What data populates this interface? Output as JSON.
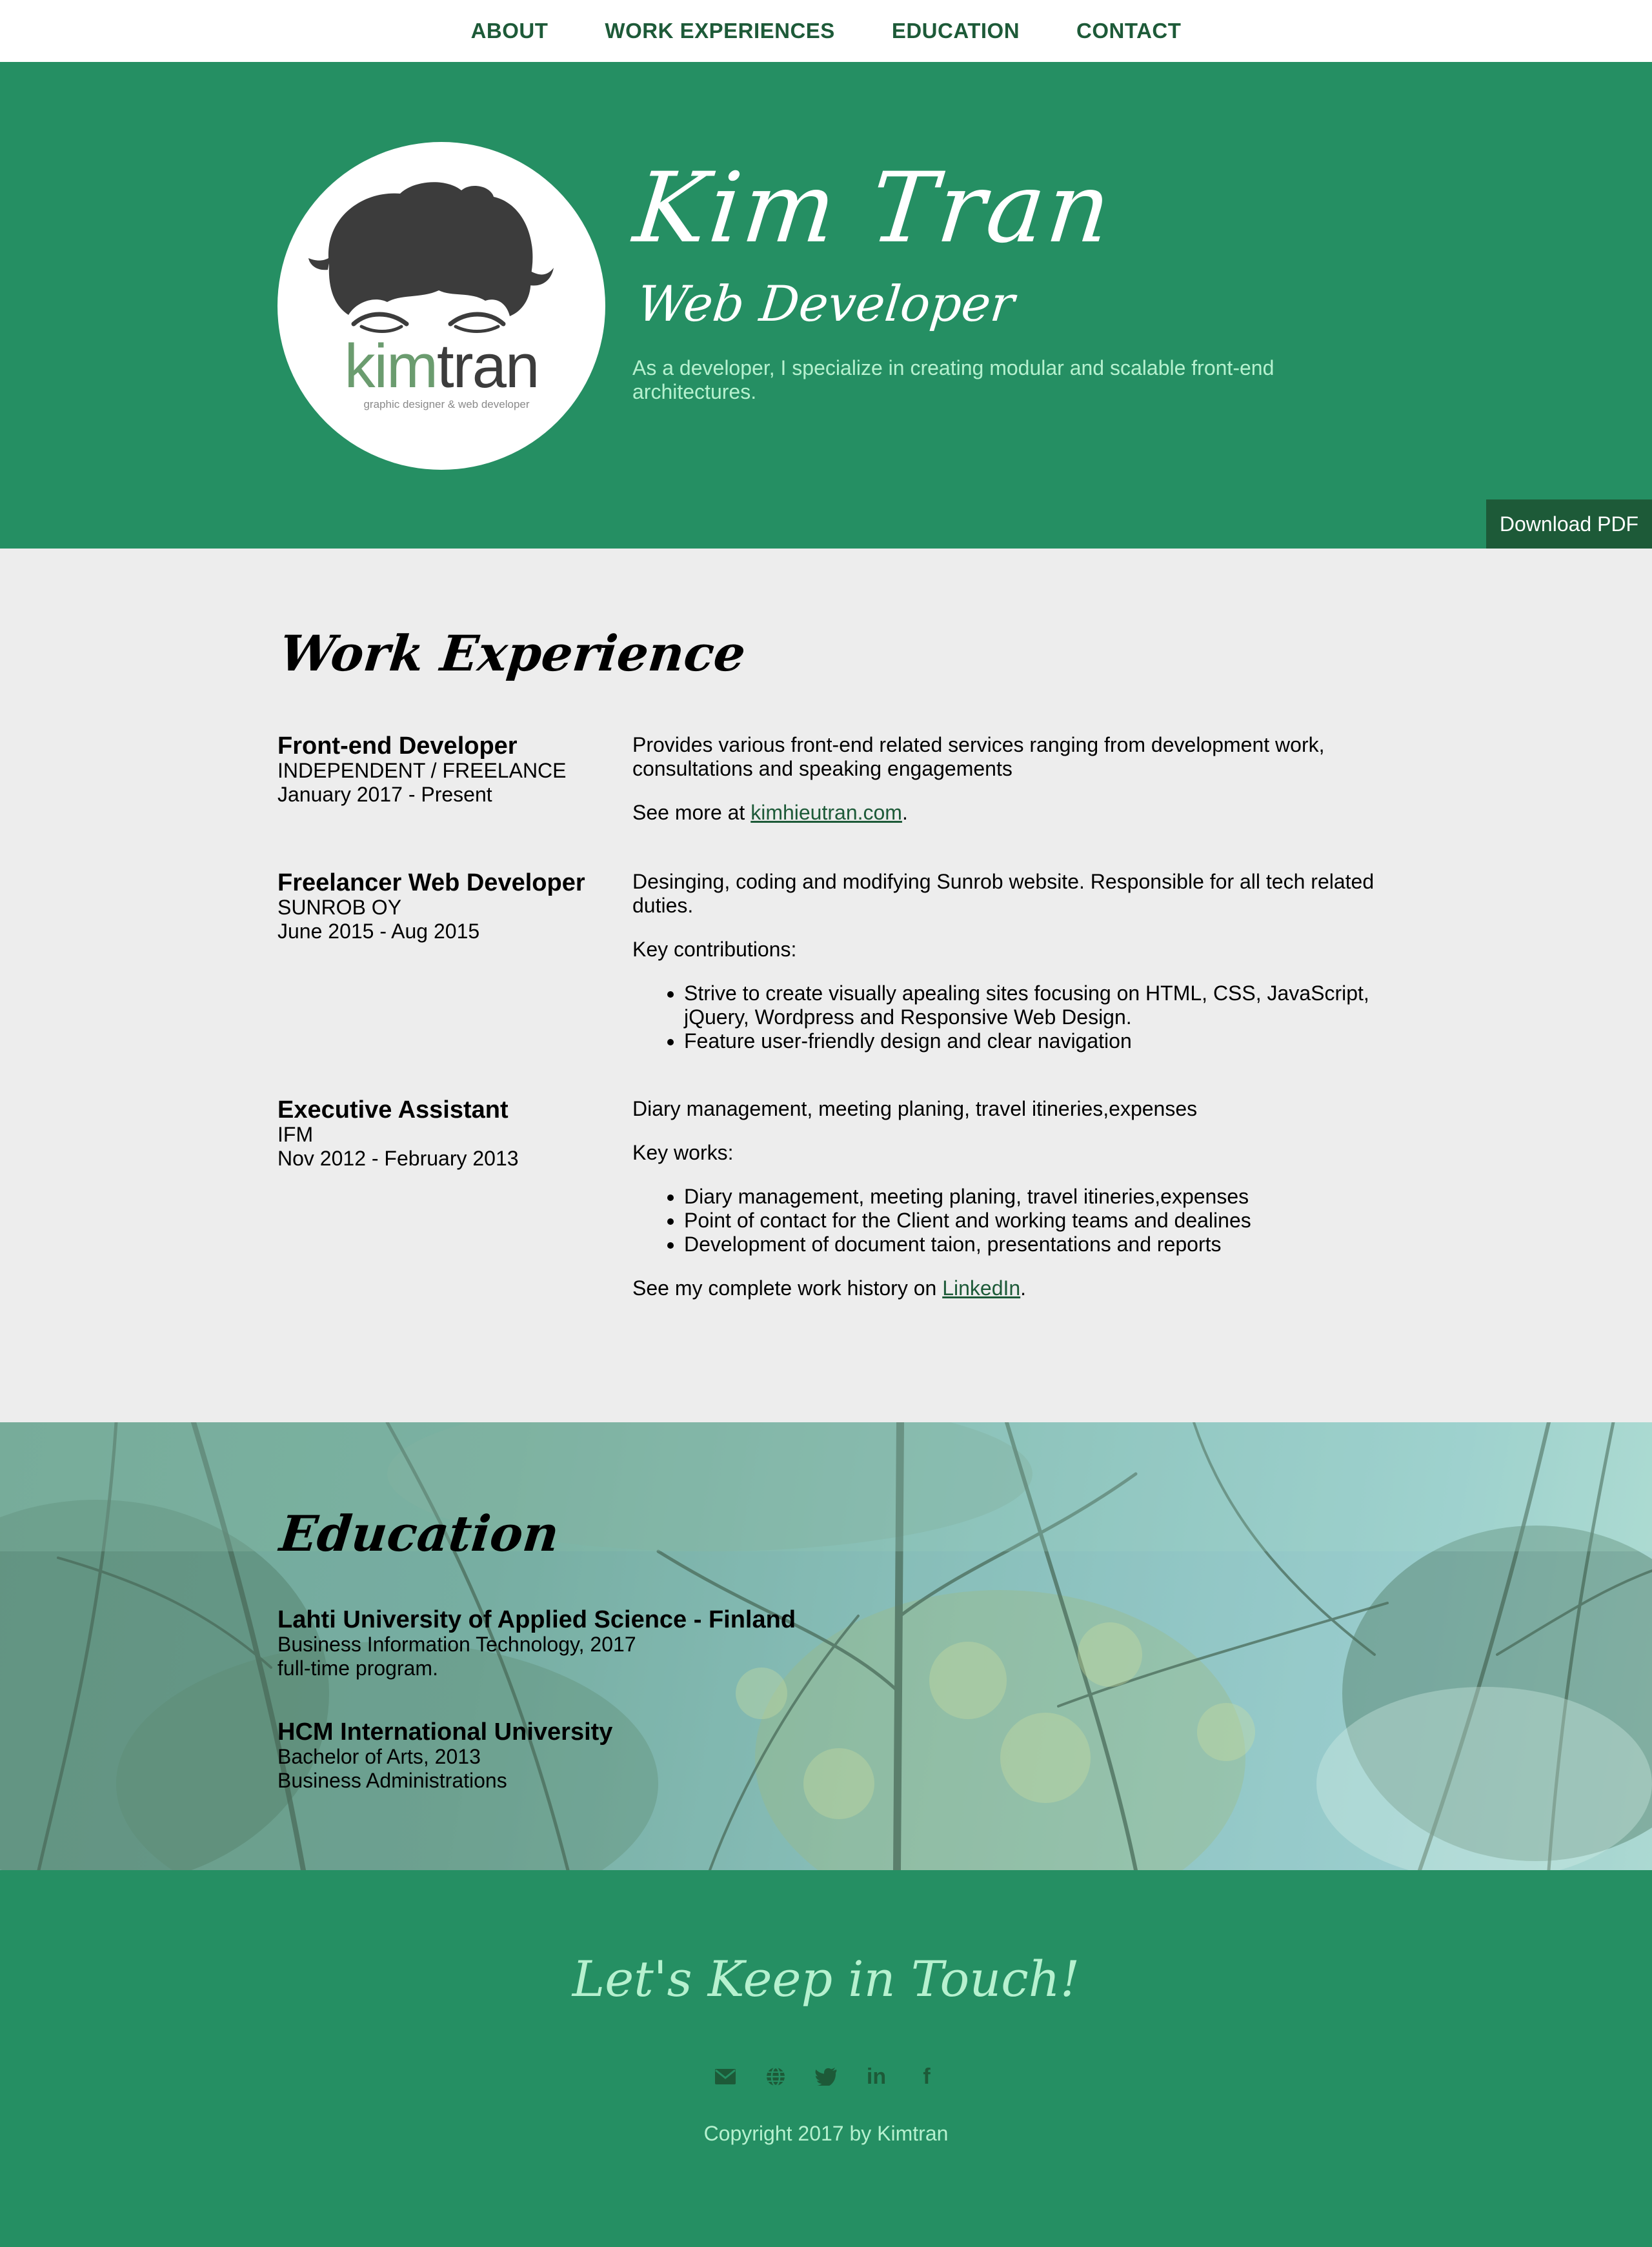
{
  "nav": {
    "items": [
      "ABOUT",
      "WORK EXPERIENCES",
      "EDUCATION",
      "CONTACT"
    ]
  },
  "hero": {
    "logo_text_green": "kim",
    "logo_text_dark": "tran",
    "logo_tagline": "graphic designer & web developer",
    "name": "Kim Tran",
    "role": "Web Developer",
    "bio": "As a developer, I specialize in creating modular and scalable front-end architectures.",
    "download_label": "Download PDF"
  },
  "work": {
    "title": "Work Experience",
    "jobs": [
      {
        "title": "Front-end Developer",
        "company": "INDEPENDENT / FREELANCE",
        "period": "January 2017 - Present",
        "description": "Provides various front-end related services ranging from development work, consultations and speaking engagements",
        "see_more_prefix": "See more at ",
        "see_more_link": "kimhieutran.com",
        "see_more_suffix": "."
      },
      {
        "title": "Freelancer Web Developer",
        "company": "SUNROB OY",
        "period": "June 2015 - Aug 2015",
        "description": "Desinging, coding and modifying Sunrob website. Responsible for all tech related duties.",
        "list_heading": "Key contributions:",
        "bullets": [
          "Strive to create visually apealing sites focusing on HTML, CSS, JavaScript, jQuery, Wordpress and Responsive Web Design.",
          "Feature user-friendly design and clear navigation"
        ]
      },
      {
        "title": "Executive Assistant",
        "company": "IFM",
        "period": "Nov 2012 - February 2013",
        "description": "Diary management, meeting planing, travel itineries,expenses",
        "list_heading": "Key works:",
        "bullets": [
          "Diary management, meeting planing, travel itineries,expenses",
          "Point of contact for the Client and working teams and dealines",
          "Development of document taion, presentations and reports"
        ],
        "history_prefix": "See my complete work history on ",
        "history_link": "LinkedIn",
        "history_suffix": "."
      }
    ]
  },
  "education": {
    "title": "Education",
    "schools": [
      {
        "name": "Lahti University of Applied Science - Finland",
        "degree": "Business Information Technology, 2017",
        "note": "full-time program."
      },
      {
        "name": "HCM International University",
        "degree": "Bachelor of Arts, 2013",
        "note": "Business Administrations"
      }
    ]
  },
  "footer": {
    "title": "Let's Keep in Touch!",
    "social_icons": [
      "email-icon",
      "globe-icon",
      "twitter-icon",
      "linkedin-icon",
      "facebook-icon"
    ],
    "linkedin_glyph": "in",
    "facebook_glyph": "f",
    "copyright": "Copyright 2017 by Kimtran"
  },
  "colors": {
    "brand_green": "#258f63",
    "dark_green": "#1d5a38",
    "mint_text": "#b6f1cf",
    "page_gray": "#ededed"
  }
}
